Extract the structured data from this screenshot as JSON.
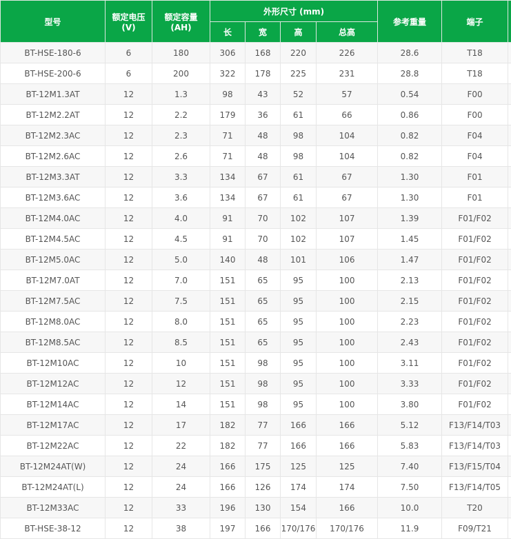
{
  "table": {
    "headers": {
      "model": "型号",
      "voltage": "额定电压\n(V)",
      "capacity": "额定容量\n(AH)",
      "dims": "外形尺寸 (mm)",
      "length": "长",
      "width": "宽",
      "height": "高",
      "total_height": "总高",
      "weight": "参考重量",
      "terminal": "端子"
    },
    "rows": [
      [
        "BT-HSE-180-6",
        "6",
        "180",
        "306",
        "168",
        "220",
        "226",
        "28.6",
        "T18"
      ],
      [
        "BT-HSE-200-6",
        "6",
        "200",
        "322",
        "178",
        "225",
        "231",
        "28.8",
        "T18"
      ],
      [
        "BT-12M1.3AT",
        "12",
        "1.3",
        "98",
        "43",
        "52",
        "57",
        "0.54",
        "F00"
      ],
      [
        "BT-12M2.2AT",
        "12",
        "2.2",
        "179",
        "36",
        "61",
        "66",
        "0.86",
        "F00"
      ],
      [
        "BT-12M2.3AC",
        "12",
        "2.3",
        "71",
        "48",
        "98",
        "104",
        "0.82",
        "F04"
      ],
      [
        "BT-12M2.6AC",
        "12",
        "2.6",
        "71",
        "48",
        "98",
        "104",
        "0.82",
        "F04"
      ],
      [
        "BT-12M3.3AT",
        "12",
        "3.3",
        "134",
        "67",
        "61",
        "67",
        "1.30",
        "F01"
      ],
      [
        "BT-12M3.6AC",
        "12",
        "3.6",
        "134",
        "67",
        "61",
        "67",
        "1.30",
        "F01"
      ],
      [
        "BT-12M4.0AC",
        "12",
        "4.0",
        "91",
        "70",
        "102",
        "107",
        "1.39",
        "F01/F02"
      ],
      [
        "BT-12M4.5AC",
        "12",
        "4.5",
        "91",
        "70",
        "102",
        "107",
        "1.45",
        "F01/F02"
      ],
      [
        "BT-12M5.0AC",
        "12",
        "5.0",
        "140",
        "48",
        "101",
        "106",
        "1.47",
        "F01/F02"
      ],
      [
        "BT-12M7.0AT",
        "12",
        "7.0",
        "151",
        "65",
        "95",
        "100",
        "2.13",
        "F01/F02"
      ],
      [
        "BT-12M7.5AC",
        "12",
        "7.5",
        "151",
        "65",
        "95",
        "100",
        "2.15",
        "F01/F02"
      ],
      [
        "BT-12M8.0AC",
        "12",
        "8.0",
        "151",
        "65",
        "95",
        "100",
        "2.23",
        "F01/F02"
      ],
      [
        "BT-12M8.5AC",
        "12",
        "8.5",
        "151",
        "65",
        "95",
        "100",
        "2.43",
        "F01/F02"
      ],
      [
        "BT-12M10AC",
        "12",
        "10",
        "151",
        "98",
        "95",
        "100",
        "3.11",
        "F01/F02"
      ],
      [
        "BT-12M12AC",
        "12",
        "12",
        "151",
        "98",
        "95",
        "100",
        "3.33",
        "F01/F02"
      ],
      [
        "BT-12M14AC",
        "12",
        "14",
        "151",
        "98",
        "95",
        "100",
        "3.80",
        "F01/F02"
      ],
      [
        "BT-12M17AC",
        "12",
        "17",
        "182",
        "77",
        "166",
        "166",
        "5.12",
        "F13/F14/T03"
      ],
      [
        "BT-12M22AC",
        "12",
        "22",
        "182",
        "77",
        "166",
        "166",
        "5.83",
        "F13/F14/T03"
      ],
      [
        "BT-12M24AT(W)",
        "12",
        "24",
        "166",
        "175",
        "125",
        "125",
        "7.40",
        "F13/F15/T04"
      ],
      [
        "BT-12M24AT(L)",
        "12",
        "24",
        "166",
        "126",
        "174",
        "174",
        "7.50",
        "F13/F14/T05"
      ],
      [
        "BT-12M33AC",
        "12",
        "33",
        "196",
        "130",
        "154",
        "166",
        "10.0",
        "T20"
      ],
      [
        "BT-HSE-38-12",
        "12",
        "38",
        "197",
        "166",
        "170/176",
        "170/176",
        "11.9",
        "F09/T21"
      ]
    ]
  },
  "colors": {
    "header_bg": "#0aa647",
    "header_text": "#ffffff",
    "row_alt_bg": "#f7f7f7",
    "cell_text": "#555555"
  }
}
